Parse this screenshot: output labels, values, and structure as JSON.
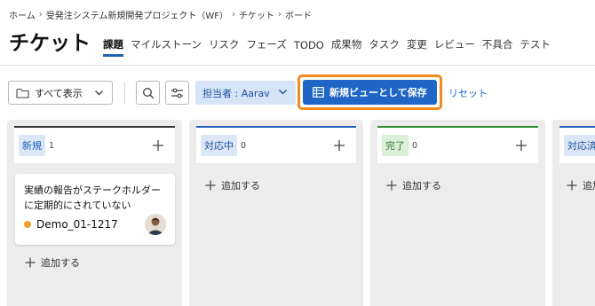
{
  "breadcrumb": {
    "items": [
      "ホーム",
      "受発注システム新規開発プロジェクト（WF）",
      "チケット",
      "ボード"
    ]
  },
  "header": {
    "title": "チケット",
    "tabs": [
      "課題",
      "マイルストーン",
      "リスク",
      "フェーズ",
      "TODO",
      "成果物",
      "タスク",
      "変更",
      "レビュー",
      "不具合",
      "テスト"
    ],
    "active_tab": "課題"
  },
  "toolbar": {
    "view_select": "すべて表示",
    "assignee_filter": "担当者 : Aarav",
    "save_view_label": "新規ビューとして保存",
    "reset_label": "リセット"
  },
  "board": {
    "add_label": "追加する",
    "columns": [
      {
        "name": "新規",
        "count": "1",
        "color": "#2361b8"
      },
      {
        "name": "対応中",
        "count": "0",
        "color": "#2361b8"
      },
      {
        "name": "完了",
        "count": "0",
        "color": "#2e8b2e"
      },
      {
        "name": "対応済",
        "count": "",
        "color": "#2361b8"
      }
    ],
    "cards": [
      {
        "title": "実績の報告がステークホルダーに定期的にされていない",
        "ticket_id": "Demo_01-1217",
        "status_color": "#f0a030"
      }
    ]
  },
  "colors": {
    "accent": "#1f66c6",
    "highlight": "#f08a1d",
    "filter_bg": "#d5e4f7"
  }
}
